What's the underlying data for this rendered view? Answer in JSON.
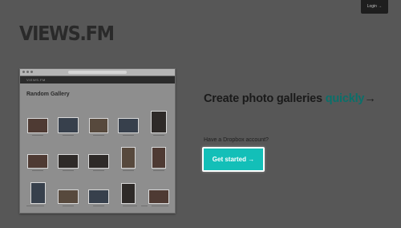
{
  "header": {
    "login_label": "Login →"
  },
  "brand": {
    "logo": "VIEWS.FM"
  },
  "hero": {
    "headline_prefix": "Create photo galleries ",
    "headline_accent": "quickly",
    "headline_arrow": "→",
    "dropbox_question": "Have a Dropbox account?",
    "cta_label": "Get started →"
  },
  "mock": {
    "header": "VIEWS.FM",
    "gallery_title": "Random Gallery"
  },
  "colors": {
    "background": "#575757",
    "accent": "#13bfb8",
    "accent_text": "#0b6f6a"
  }
}
